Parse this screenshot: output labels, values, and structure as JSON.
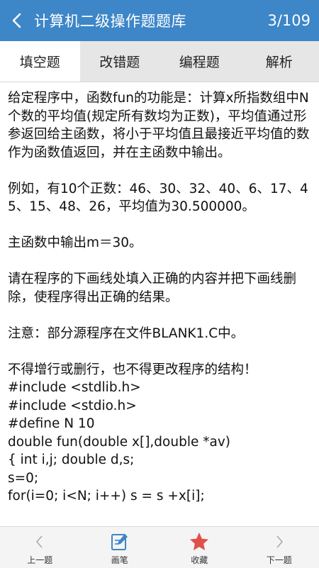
{
  "header": {
    "back_icon": "chevron-left-icon",
    "title": "计算机二级操作题题库",
    "counter": "3/109",
    "bg_color": "#3d86c8"
  },
  "tabs": [
    {
      "label": "填空题",
      "active": true
    },
    {
      "label": "改错题",
      "active": false
    },
    {
      "label": "编程题",
      "active": false
    },
    {
      "label": "解析",
      "active": false
    }
  ],
  "question": {
    "paragraphs": [
      "给定程序中，函数fun的功能是：计算x所指数组中N个数的平均值(规定所有数均为正数)，平均值通过形参返回给主函数，将小于平均值且最接近平均值的数作为函数值返回，并在主函数中输出。",
      "例如，有10个正数：46、30、32、40、6、17、45、15、48、26，平均值为30.500000。",
      "主函数中输出m＝30。",
      "请在程序的下画线处填入正确的内容并把下画线删除，使程序得出正确的结果。",
      "注意：部分源程序在文件BLANK1.C中。"
    ],
    "code_lines": [
      "不得增行或删行，也不得更改程序的结构！",
      "#include <stdlib.h>",
      "#include <stdio.h>",
      "#define N 10",
      "double fun(double x[],double *av)",
      "{ int i,j; double d,s;",
      "s=0;",
      "for(i=0; i<N; i++) s = s +x[i];"
    ]
  },
  "bottom_nav": [
    {
      "label": "上一题",
      "icon": "chevron-left-icon",
      "color": "#aaaaaa"
    },
    {
      "label": "画笔",
      "icon": "pencil-note-icon",
      "color": "#3d86c8"
    },
    {
      "label": "收藏",
      "icon": "star-icon",
      "color": "#e0504a"
    },
    {
      "label": "下一题",
      "icon": "chevron-right-icon",
      "color": "#aaaaaa"
    }
  ]
}
